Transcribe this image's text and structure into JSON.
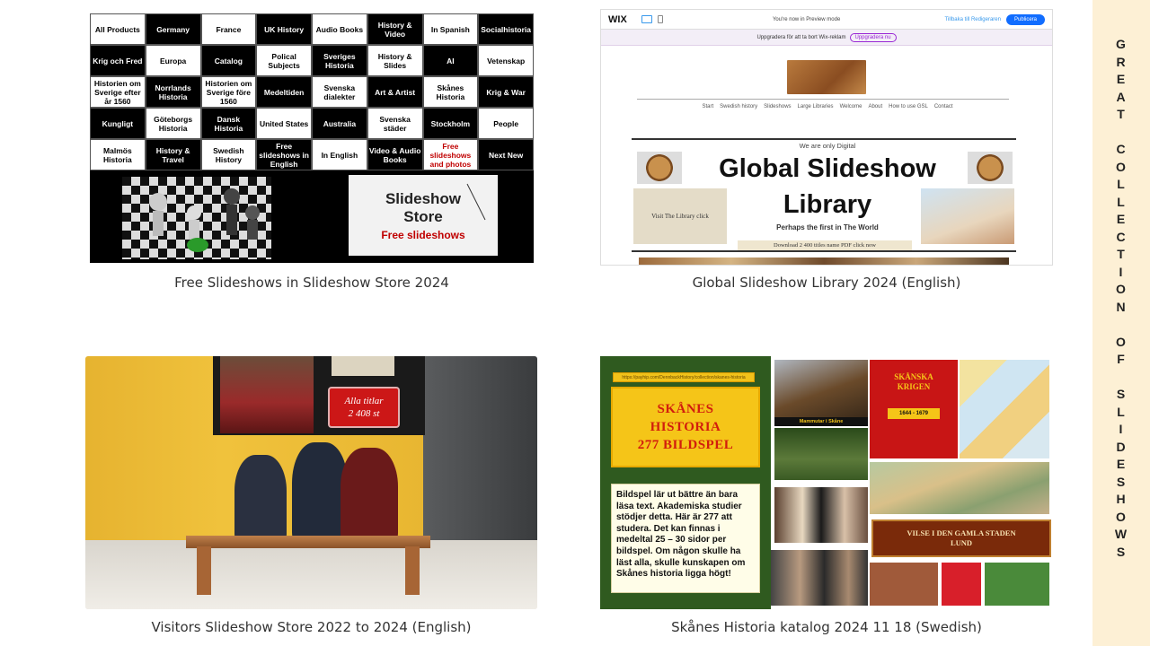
{
  "tiles": [
    {
      "caption": "Free Slideshows in Slideshow Store 2024",
      "grid": [
        {
          "label": "All Products",
          "style": "w"
        },
        {
          "label": "Germany",
          "style": "b"
        },
        {
          "label": "France",
          "style": "w"
        },
        {
          "label": "UK History",
          "style": "b"
        },
        {
          "label": "Audio Books",
          "style": "w"
        },
        {
          "label": "History & Video",
          "style": "b"
        },
        {
          "label": "In Spanish",
          "style": "w"
        },
        {
          "label": "Socialhistoria",
          "style": "b"
        },
        {
          "label": "Krig och Fred",
          "style": "b"
        },
        {
          "label": "Europa",
          "style": "w"
        },
        {
          "label": "Catalog",
          "style": "b"
        },
        {
          "label": "Polical Subjects",
          "style": "w"
        },
        {
          "label": "Sveriges Historia",
          "style": "b"
        },
        {
          "label": "History & Slides",
          "style": "w"
        },
        {
          "label": "AI",
          "style": "b"
        },
        {
          "label": "Vetenskap",
          "style": "w"
        },
        {
          "label": "Historien om Sverige efter år 1560",
          "style": "w"
        },
        {
          "label": "Norrlands Historia",
          "style": "b"
        },
        {
          "label": "Historien om Sverige före 1560",
          "style": "w"
        },
        {
          "label": "Medeltiden",
          "style": "b"
        },
        {
          "label": "Svenska dialekter",
          "style": "w"
        },
        {
          "label": "Art & Artist",
          "style": "b"
        },
        {
          "label": "Skånes Historia",
          "style": "w"
        },
        {
          "label": "Krig & War",
          "style": "b"
        },
        {
          "label": "Kungligt",
          "style": "b"
        },
        {
          "label": "Göteborgs Historia",
          "style": "w"
        },
        {
          "label": "Dansk Historia",
          "style": "b"
        },
        {
          "label": "United States",
          "style": "w"
        },
        {
          "label": "Australia",
          "style": "b"
        },
        {
          "label": "Svenska städer",
          "style": "w"
        },
        {
          "label": "Stockholm",
          "style": "b"
        },
        {
          "label": "People",
          "style": "w"
        },
        {
          "label": "Malmös Historia",
          "style": "w"
        },
        {
          "label": "History & Travel",
          "style": "b"
        },
        {
          "label": "Swedish History",
          "style": "w"
        },
        {
          "label": "Free slideshows in English",
          "style": "b"
        },
        {
          "label": "In English",
          "style": "w"
        },
        {
          "label": "Video & Audio Books",
          "style": "b"
        },
        {
          "label": "Free slideshows and photos",
          "style": "w red"
        },
        {
          "label": "Next New",
          "style": "b"
        }
      ],
      "store_title_1": "Slideshow",
      "store_title_2": "Store",
      "store_free": "Free slideshows"
    },
    {
      "caption": "Global Slideshow Library 2024 (English)",
      "wix_logo": "WIX",
      "preview_text": "You're now in Preview mode",
      "back_text": "Tillbaka till Redigeraren",
      "publish_text": "Publicera",
      "upgrade_text": "Uppgradera för att ta bort Wix-reklam",
      "upgrade_btn": "Uppgradera nu",
      "nav": [
        "Start",
        "Swedish history",
        "Slideshows",
        "Large Libraries",
        "Welcome",
        "About",
        "How to use GSL",
        "Contact"
      ],
      "digital": "We are only Digital",
      "title_1": "Global Slideshow",
      "title_2": "Library",
      "first": "Perhaps the first in The World",
      "visit": "Visit The Library click",
      "download": "Download 2 400 titles name PDF click now"
    },
    {
      "caption": "Visitors Slideshow Store 2022 to 2024 (English)",
      "titlar_1": "Alla titlar",
      "titlar_2": "2 408 st"
    },
    {
      "caption": "Skånes Historia katalog 2024 11 18 (Swedish)",
      "url": "https://payhip.com/DennbackHistory/collection/skanes-historia",
      "heading_1": "SKÅNES",
      "heading_2": "HISTORIA",
      "heading_3": "277 BILDSPEL",
      "body": "Bildspel lär ut bättre än bara läsa text. Akademiska studier stödjer detta. Här är 277 att studera. Det kan finnas i medeltal 25 – 30 sidor per bildspel. Om någon skulle ha läst alla, skulle kunskapen om Skånes historia ligga högt!",
      "mammut": "Mammutar i Skåne",
      "krig_1": "SKÅNSKA",
      "krig_2": "KRIGEN",
      "krig_years": "1644 - 1679",
      "vilse_1": "VILSE I DEN GAMLA STADEN",
      "vilse_2": "LUND"
    }
  ],
  "side_banner": [
    "G",
    "R",
    "E",
    "A",
    "T",
    " ",
    "C",
    "O",
    "L",
    "L",
    "E",
    "C",
    "T",
    "I",
    "O",
    "N",
    " ",
    "O",
    "F",
    " ",
    "S",
    "L",
    "I",
    "D",
    "E",
    "S",
    "H",
    "O",
    "W",
    "S"
  ]
}
